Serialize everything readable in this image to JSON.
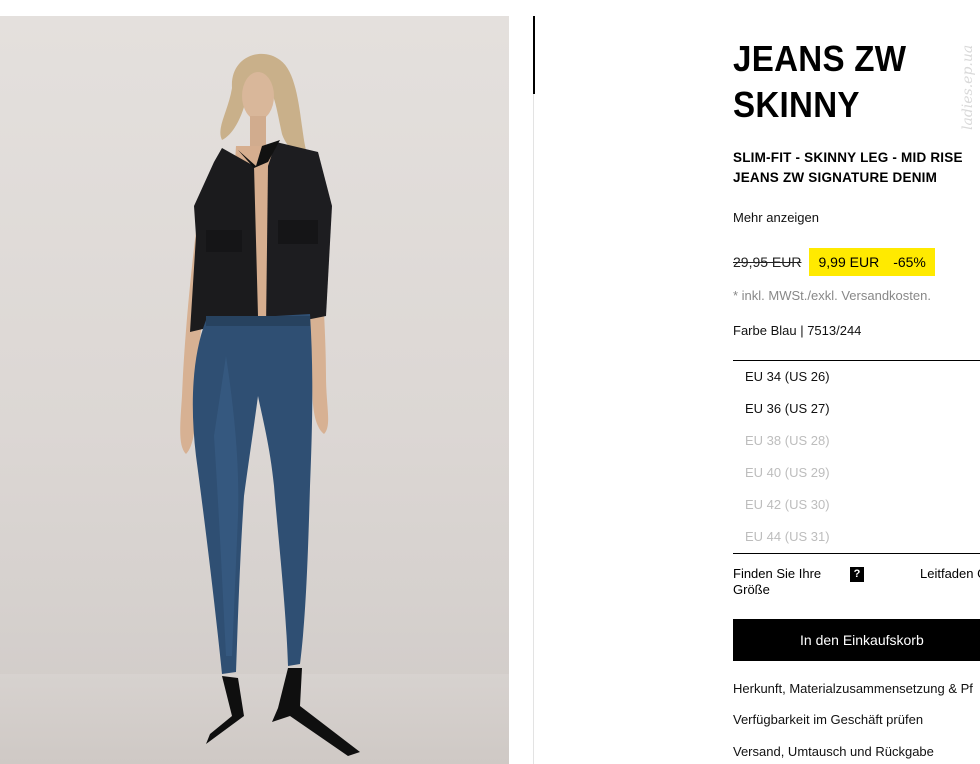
{
  "product": {
    "title": "JEANS ZW SKINNY",
    "subtitle": "SLIM-FIT - SKINNY LEG - MID RISE JEANS ZW SIGNATURE DENIM",
    "more_link": "Mehr anzeigen",
    "old_price": "29,95 EUR",
    "sale_price": "9,99 EUR",
    "discount": "-65%",
    "tax_note": "* inkl. MWSt./exkl. Versandkosten.",
    "color_info": "Farbe Blau | 7513/244",
    "sizes": [
      {
        "label": "EU 34 (US 26)",
        "available": true
      },
      {
        "label": "EU 36 (US 27)",
        "available": true
      },
      {
        "label": "EU 38 (US 28)",
        "available": false
      },
      {
        "label": "EU 40 (US 29)",
        "available": false
      },
      {
        "label": "EU 42 (US 30)",
        "available": false
      },
      {
        "label": "EU 44 (US 31)",
        "available": false
      }
    ],
    "size_help": "Finden Sie Ihre Größe",
    "size_help_icon": "?",
    "size_guide": "Leitfaden Größen",
    "cart_button": "In den Einkaufskorb",
    "info_links": [
      "Herkunft, Materialzusammensetzung & Pf",
      "Verfügbarkeit im Geschäft prüfen",
      "Versand, Umtausch und Rückgabe"
    ]
  },
  "watermark": "ladies.ep.ua",
  "colors": {
    "sale_highlight": "#ffea00",
    "button_bg": "#000000",
    "disabled_text": "#bdbdbd",
    "denim": "#2f4f73",
    "vest": "#1b1b1d"
  },
  "icons": {
    "size_help": "question-mark-icon"
  }
}
